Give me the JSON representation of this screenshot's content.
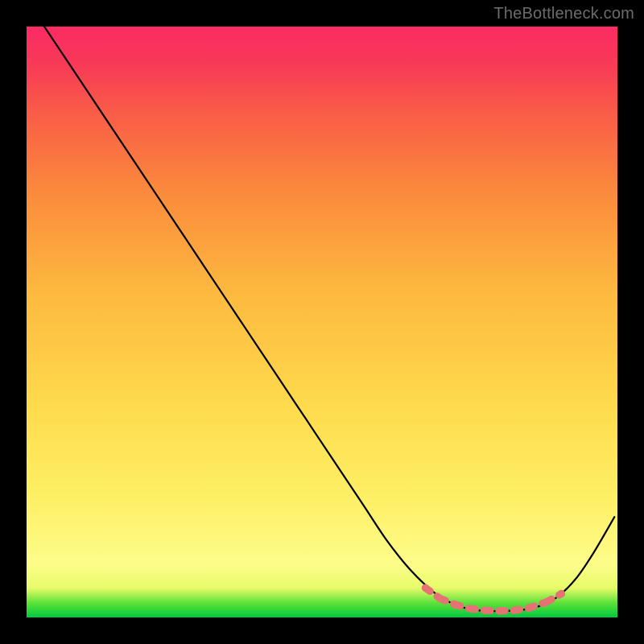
{
  "watermark": "TheBottleneck.com",
  "colors": {
    "curve": "#000000",
    "marker_fill": "#e57373",
    "marker_stroke": "#cf5a5a"
  },
  "chart_data": {
    "type": "line",
    "title": "",
    "xlabel": "",
    "ylabel": "",
    "xlim": [
      0,
      100
    ],
    "ylim": [
      0,
      100
    ],
    "grid": false,
    "series": [
      {
        "name": "bottleneck-curve",
        "x": [
          3,
          7,
          12,
          17,
          22,
          27,
          32,
          37,
          42,
          47,
          52,
          57,
          61,
          65,
          69,
          72,
          75,
          78,
          81,
          84,
          87,
          90,
          93,
          96,
          99.5
        ],
        "values": [
          100,
          94,
          86.5,
          79,
          71.5,
          64,
          56.5,
          49,
          41.5,
          34,
          26.5,
          19,
          13,
          8,
          4.2,
          2.4,
          1.4,
          1.1,
          1.1,
          1.3,
          2.0,
          3.6,
          6.6,
          11.0,
          17.0
        ]
      }
    ],
    "markers": {
      "name": "highlighted-range",
      "x": [
        67.5,
        70,
        72.5,
        75,
        77.5,
        80,
        82.5,
        85,
        88,
        90.5
      ],
      "values": [
        5.0,
        3.2,
        2.2,
        1.5,
        1.2,
        1.1,
        1.2,
        1.6,
        2.6,
        4.0
      ],
      "style": "dotted"
    }
  }
}
